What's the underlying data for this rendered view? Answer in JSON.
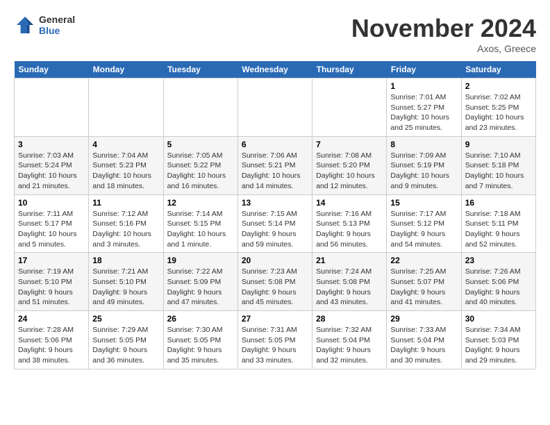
{
  "header": {
    "logo_general": "General",
    "logo_blue": "Blue",
    "month_title": "November 2024",
    "location": "Axos, Greece"
  },
  "weekdays": [
    "Sunday",
    "Monday",
    "Tuesday",
    "Wednesday",
    "Thursday",
    "Friday",
    "Saturday"
  ],
  "weeks": [
    [
      {
        "day": "",
        "info": ""
      },
      {
        "day": "",
        "info": ""
      },
      {
        "day": "",
        "info": ""
      },
      {
        "day": "",
        "info": ""
      },
      {
        "day": "",
        "info": ""
      },
      {
        "day": "1",
        "info": "Sunrise: 7:01 AM\nSunset: 5:27 PM\nDaylight: 10 hours and 25 minutes."
      },
      {
        "day": "2",
        "info": "Sunrise: 7:02 AM\nSunset: 5:25 PM\nDaylight: 10 hours and 23 minutes."
      }
    ],
    [
      {
        "day": "3",
        "info": "Sunrise: 7:03 AM\nSunset: 5:24 PM\nDaylight: 10 hours and 21 minutes."
      },
      {
        "day": "4",
        "info": "Sunrise: 7:04 AM\nSunset: 5:23 PM\nDaylight: 10 hours and 18 minutes."
      },
      {
        "day": "5",
        "info": "Sunrise: 7:05 AM\nSunset: 5:22 PM\nDaylight: 10 hours and 16 minutes."
      },
      {
        "day": "6",
        "info": "Sunrise: 7:06 AM\nSunset: 5:21 PM\nDaylight: 10 hours and 14 minutes."
      },
      {
        "day": "7",
        "info": "Sunrise: 7:08 AM\nSunset: 5:20 PM\nDaylight: 10 hours and 12 minutes."
      },
      {
        "day": "8",
        "info": "Sunrise: 7:09 AM\nSunset: 5:19 PM\nDaylight: 10 hours and 9 minutes."
      },
      {
        "day": "9",
        "info": "Sunrise: 7:10 AM\nSunset: 5:18 PM\nDaylight: 10 hours and 7 minutes."
      }
    ],
    [
      {
        "day": "10",
        "info": "Sunrise: 7:11 AM\nSunset: 5:17 PM\nDaylight: 10 hours and 5 minutes."
      },
      {
        "day": "11",
        "info": "Sunrise: 7:12 AM\nSunset: 5:16 PM\nDaylight: 10 hours and 3 minutes."
      },
      {
        "day": "12",
        "info": "Sunrise: 7:14 AM\nSunset: 5:15 PM\nDaylight: 10 hours and 1 minute."
      },
      {
        "day": "13",
        "info": "Sunrise: 7:15 AM\nSunset: 5:14 PM\nDaylight: 9 hours and 59 minutes."
      },
      {
        "day": "14",
        "info": "Sunrise: 7:16 AM\nSunset: 5:13 PM\nDaylight: 9 hours and 56 minutes."
      },
      {
        "day": "15",
        "info": "Sunrise: 7:17 AM\nSunset: 5:12 PM\nDaylight: 9 hours and 54 minutes."
      },
      {
        "day": "16",
        "info": "Sunrise: 7:18 AM\nSunset: 5:11 PM\nDaylight: 9 hours and 52 minutes."
      }
    ],
    [
      {
        "day": "17",
        "info": "Sunrise: 7:19 AM\nSunset: 5:10 PM\nDaylight: 9 hours and 51 minutes."
      },
      {
        "day": "18",
        "info": "Sunrise: 7:21 AM\nSunset: 5:10 PM\nDaylight: 9 hours and 49 minutes."
      },
      {
        "day": "19",
        "info": "Sunrise: 7:22 AM\nSunset: 5:09 PM\nDaylight: 9 hours and 47 minutes."
      },
      {
        "day": "20",
        "info": "Sunrise: 7:23 AM\nSunset: 5:08 PM\nDaylight: 9 hours and 45 minutes."
      },
      {
        "day": "21",
        "info": "Sunrise: 7:24 AM\nSunset: 5:08 PM\nDaylight: 9 hours and 43 minutes."
      },
      {
        "day": "22",
        "info": "Sunrise: 7:25 AM\nSunset: 5:07 PM\nDaylight: 9 hours and 41 minutes."
      },
      {
        "day": "23",
        "info": "Sunrise: 7:26 AM\nSunset: 5:06 PM\nDaylight: 9 hours and 40 minutes."
      }
    ],
    [
      {
        "day": "24",
        "info": "Sunrise: 7:28 AM\nSunset: 5:06 PM\nDaylight: 9 hours and 38 minutes."
      },
      {
        "day": "25",
        "info": "Sunrise: 7:29 AM\nSunset: 5:05 PM\nDaylight: 9 hours and 36 minutes."
      },
      {
        "day": "26",
        "info": "Sunrise: 7:30 AM\nSunset: 5:05 PM\nDaylight: 9 hours and 35 minutes."
      },
      {
        "day": "27",
        "info": "Sunrise: 7:31 AM\nSunset: 5:05 PM\nDaylight: 9 hours and 33 minutes."
      },
      {
        "day": "28",
        "info": "Sunrise: 7:32 AM\nSunset: 5:04 PM\nDaylight: 9 hours and 32 minutes."
      },
      {
        "day": "29",
        "info": "Sunrise: 7:33 AM\nSunset: 5:04 PM\nDaylight: 9 hours and 30 minutes."
      },
      {
        "day": "30",
        "info": "Sunrise: 7:34 AM\nSunset: 5:03 PM\nDaylight: 9 hours and 29 minutes."
      }
    ]
  ]
}
